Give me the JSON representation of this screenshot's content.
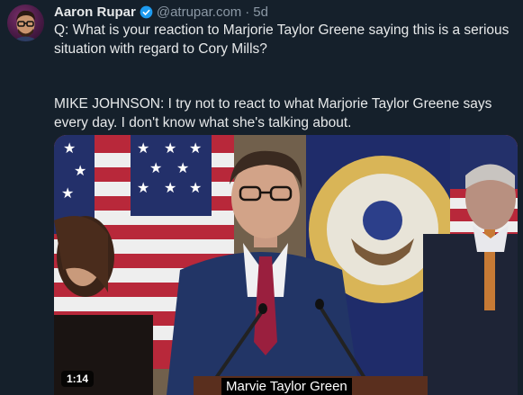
{
  "tweet": {
    "author_name": "Aaron Rupar",
    "handle": "@atrupar.com",
    "separator": "·",
    "time": "5d",
    "verified_icon": "verified-badge-icon",
    "paragraphs": [
      "Q: What is your reaction to Marjorie Taylor Greene saying this is a serious situation with regard to Cory Mills?",
      "MIKE JOHNSON: I try not to react to what Marjorie Taylor Greene says every day. I don't know what she's talking about."
    ]
  },
  "video": {
    "duration": "1:14",
    "caption": "Marvie Taylor Green"
  },
  "colors": {
    "background": "#15202b",
    "text": "#e7e9ea",
    "muted": "#8b98a5",
    "verified": "#1d9bf0"
  }
}
